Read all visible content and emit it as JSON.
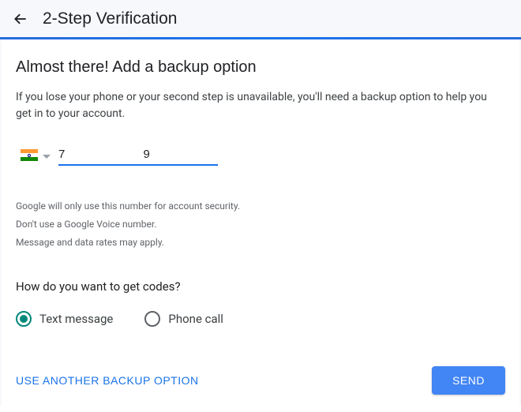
{
  "header": {
    "title": "2-Step Verification"
  },
  "main": {
    "heading": "Almost there! Add a backup option",
    "description": "If you lose your phone or your second step is unavailable, you'll need a backup option to help you get in to your account.",
    "phone": {
      "country_flag": "india",
      "value": "7                   9"
    },
    "fineprint": {
      "line1": "Google will only use this number for account security.",
      "line2": "Don't use a Google Voice number.",
      "line3": "Message and data rates may apply."
    },
    "code_question": "How do you want to get codes?",
    "radios": {
      "text_message": "Text message",
      "phone_call": "Phone call",
      "selected": "text_message"
    }
  },
  "footer": {
    "alt_option": "Use another backup option",
    "send": "Send"
  }
}
